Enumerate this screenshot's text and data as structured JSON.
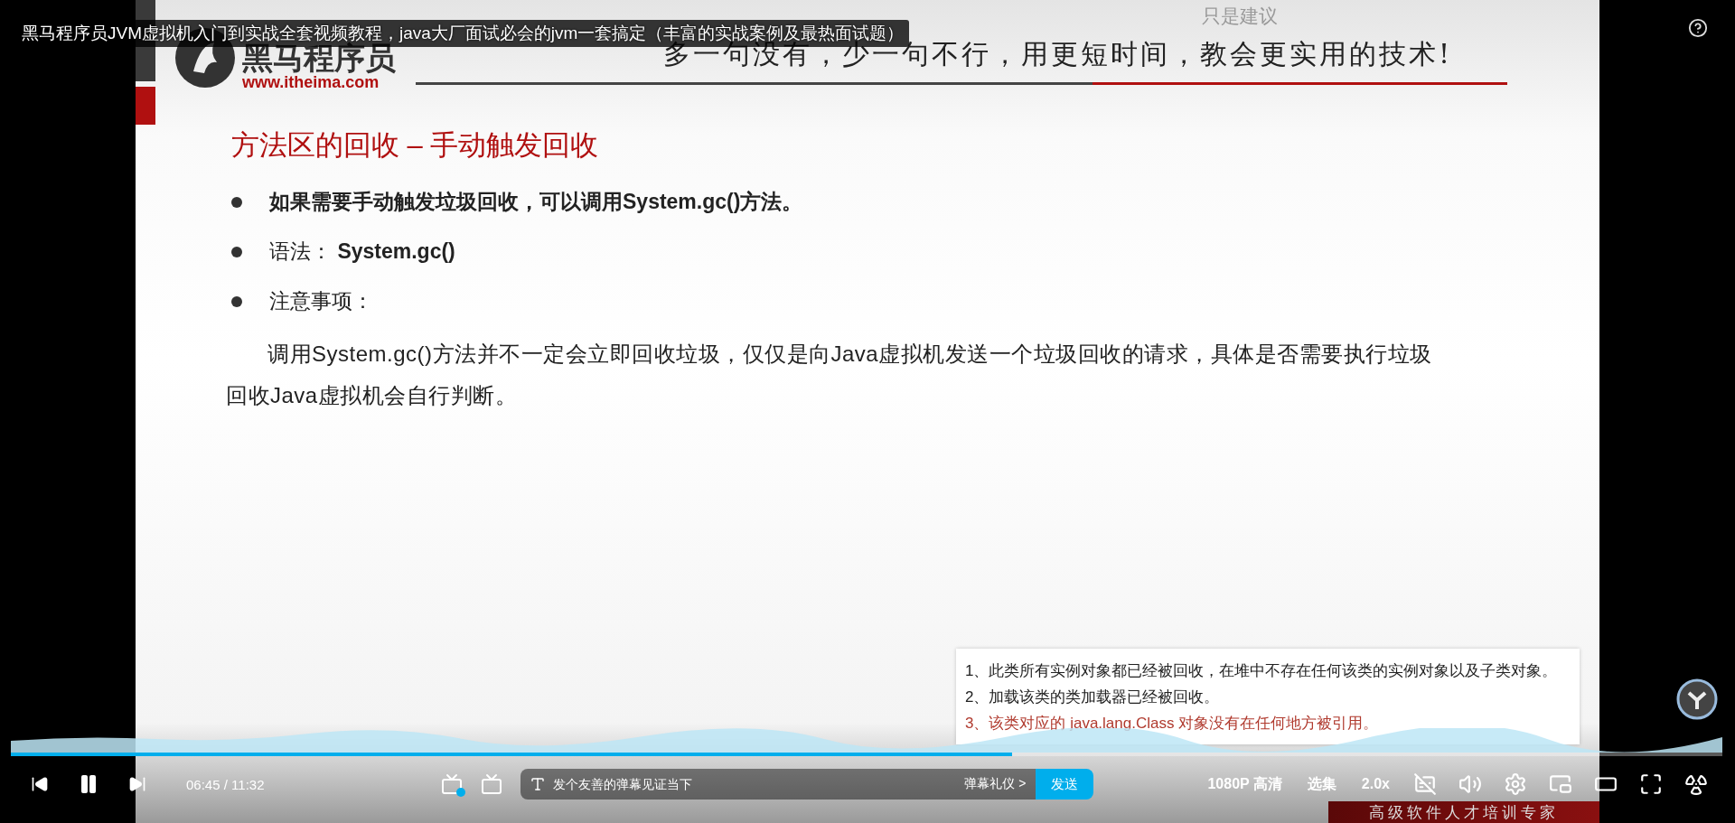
{
  "video_title": "黑马程序员JVM虚拟机入门到实战全套视频教程，java大厂面试必会的jvm一套搞定（丰富的实战案例及最热面试题）",
  "danmaku": [
    {
      "text": "只是建议"
    }
  ],
  "slide": {
    "logo_name": "黑马程序员",
    "logo_url": "www.itheima.com",
    "slogan": "多一句没有，少一句不行，用更短时间，教会更实用的技术!",
    "title": "方法区的回收 – 手动触发回收",
    "bullets": [
      {
        "kind": "strong",
        "text": "如果需要手动触发垃圾回收，可以调用System.gc()方法。"
      },
      {
        "kind": "normal",
        "text": "语法： **System.gc()**"
      },
      {
        "kind": "normal",
        "text": "注意事项："
      }
    ],
    "paragraph": "调用System.gc()方法并不一定会立即回收垃圾，仅仅是向Java虚拟机发送一个垃圾回收的请求，具体是否需要执行垃圾回收Java虚拟机会自行判断。",
    "banner": "高级软件人才培训专家"
  },
  "popup": {
    "lines": [
      {
        "text": "1、此类所有实例对象都已经被回收，在堆中不存在任何该类的实例对象以及子类对象。",
        "color": "#222222"
      },
      {
        "text": "2、加载该类的类加载器已经被回收。",
        "color": "#222222"
      },
      {
        "text": "3、该类对应的 java.lang.Class 对象没有在任何地方被引用。",
        "color": "#b03a2e"
      }
    ]
  },
  "player": {
    "progress": {
      "level": 0.585
    },
    "playing": true,
    "time_current": "06:45",
    "time_separator": "/",
    "time_total": "11:32",
    "danmaku_on": true,
    "danmaku_input": {
      "placeholder": "发个友善的弹幕见证当下"
    },
    "etiquette_link": "弹幕礼仪 >",
    "send_button": "发送",
    "quality": "1080P 高清",
    "episodes": "选集",
    "speed": "2.0x",
    "subtitles_on": false
  }
}
